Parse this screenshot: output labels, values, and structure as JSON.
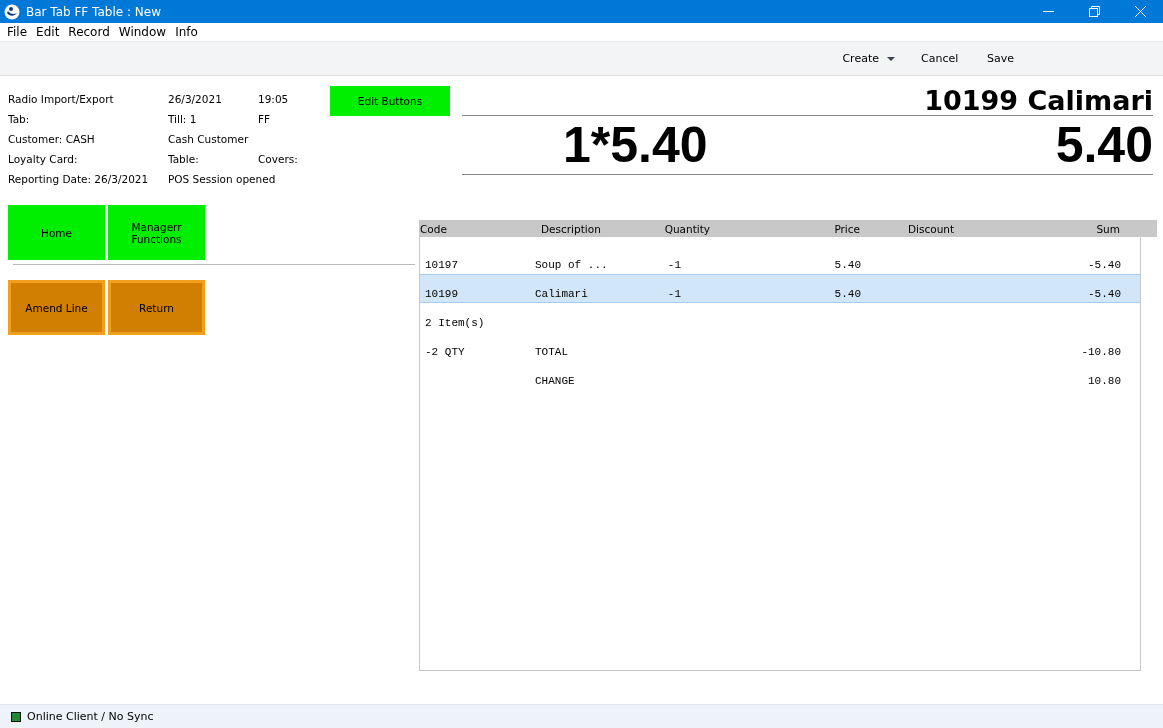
{
  "window": {
    "title": "Bar Tab FF Table : New"
  },
  "menu": [
    "File",
    "Edit",
    "Record",
    "Window",
    "Info"
  ],
  "toolbar": [
    {
      "label": "Create",
      "kind": "dropdown"
    },
    {
      "label": "Cancel",
      "kind": "plain"
    },
    {
      "label": "Save",
      "kind": "plain"
    }
  ],
  "info_rows": [
    [
      "Radio Import/Export",
      "26/3/2021",
      "19:05"
    ],
    [
      "Tab:",
      "Till: 1",
      "FF"
    ],
    [
      "Customer: CASH",
      "Cash Customer"
    ],
    [
      "Loyalty Card:",
      "Table:",
      "Covers:"
    ],
    [
      "Reporting Date: 26/3/2021",
      "POS Session opened"
    ]
  ],
  "edit_button": "Edit Buttons",
  "display": {
    "item": "10199 Calimari",
    "calculation": "1*5.40",
    "amount": "5.40"
  },
  "nav_buttons": [
    "Home",
    "Managerr Functions"
  ],
  "line_buttons": [
    "Amend Line",
    "Return"
  ],
  "table": {
    "columns": [
      "Code",
      "Description",
      "Quantity",
      "Price",
      "Discount",
      "Sum"
    ],
    "rows": [
      {
        "code": "10197",
        "description": "Soup of ...",
        "quantity": "-1",
        "price": "5.40",
        "sum": "-5.40",
        "selected": false
      },
      {
        "code": "10199",
        "description": "Calimari",
        "quantity": "-1",
        "price": "5.40",
        "sum": "-5.40",
        "selected": true
      },
      {
        "code": "2 Item(s)",
        "selected": false
      },
      {
        "code": "-2 QTY",
        "description": "TOTAL",
        "sum": "-10.80",
        "selected": false
      },
      {
        "description": "CHANGE",
        "sum": "10.80",
        "selected": false
      }
    ]
  },
  "status_bar": "Online Client / No Sync"
}
